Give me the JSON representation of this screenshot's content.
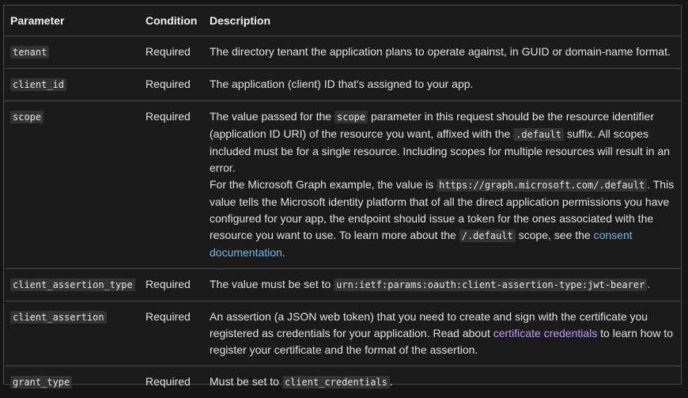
{
  "headers": {
    "parameter": "Parameter",
    "condition": "Condition",
    "description": "Description"
  },
  "rows": [
    {
      "param": "tenant",
      "cond": "Required",
      "desc": "The directory tenant the application plans to operate against, in GUID or domain-name format."
    },
    {
      "param": "client_id",
      "cond": "Required",
      "desc": "The application (client) ID that's assigned to your app."
    },
    {
      "param": "scope",
      "cond": "Required",
      "p1_a": "The value passed for the ",
      "p1_code1": "scope",
      "p1_b": " parameter in this request should be the resource identifier (application ID URI) of the resource you want, affixed with the ",
      "p1_code2": ".default",
      "p1_c": " suffix. All scopes included must be for a single resource. Including scopes for multiple resources will result in an error.",
      "p2_a": "For the Microsoft Graph example, the value is ",
      "p2_code1": "https://graph.microsoft.com/.default",
      "p2_b": ". This value tells the Microsoft identity platform that of all the direct application permissions you have configured for your app, the endpoint should issue a token for the ones associated with the resource you want to use. To learn more about the ",
      "p2_code2": "/.default",
      "p2_c": " scope, see the ",
      "p2_link": "consent documentation",
      "p2_d": "."
    },
    {
      "param": "client_assertion_type",
      "cond": "Required",
      "desc_a": "The value must be set to ",
      "desc_code": "urn:ietf:params:oauth:client-assertion-type:jwt-bearer",
      "desc_b": "."
    },
    {
      "param": "client_assertion",
      "cond": "Required",
      "desc_a": "An assertion (a JSON web token) that you need to create and sign with the certificate you registered as credentials for your application. Read about ",
      "desc_link": "certificate credentials",
      "desc_b": " to learn how to register your certificate and the format of the assertion."
    },
    {
      "param": "grant_type",
      "cond": "Required",
      "desc_a": "Must be set to ",
      "desc_code": "client_credentials",
      "desc_b": "."
    }
  ]
}
